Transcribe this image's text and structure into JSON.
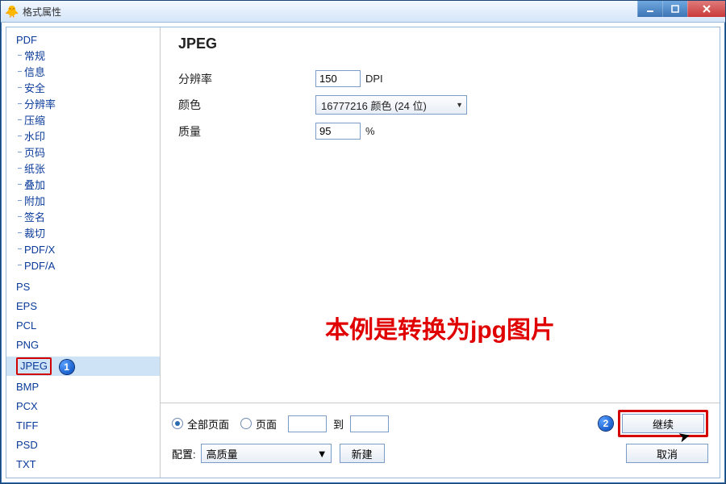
{
  "window": {
    "title": "格式属性",
    "icon_glyph": "🐥"
  },
  "sidebar": {
    "groups": [
      {
        "label": "PDF",
        "children": [
          "常规",
          "信息",
          "安全",
          "分辨率",
          "压缩",
          "水印",
          "页码",
          "纸张",
          "叠加",
          "附加",
          "签名",
          "裁切",
          "PDF/X",
          "PDF/A"
        ]
      },
      {
        "label": "PS"
      },
      {
        "label": "EPS"
      },
      {
        "label": "PCL"
      },
      {
        "label": "PNG"
      },
      {
        "label": "JPEG",
        "selected": true
      },
      {
        "label": "BMP"
      },
      {
        "label": "PCX"
      },
      {
        "label": "TIFF"
      },
      {
        "label": "PSD"
      },
      {
        "label": "TXT"
      }
    ]
  },
  "main": {
    "heading": "JPEG",
    "rows": {
      "resolution": {
        "label": "分辨率",
        "value": "150",
        "unit": "DPI"
      },
      "color": {
        "label": "颜色",
        "value": "16777216 颜色 (24 位)"
      },
      "quality": {
        "label": "质量",
        "value": "95",
        "unit": "%"
      }
    },
    "annotation": "本例是转换为jpg图片"
  },
  "bottom": {
    "radio_all": "全部页面",
    "radio_range": "页面",
    "to_label": "到",
    "range_from": "",
    "range_to": "",
    "config_label": "配置:",
    "config_value": "高质量",
    "new_btn": "新建",
    "continue_btn": "继续",
    "cancel_btn": "取消"
  },
  "badges": {
    "one": "1",
    "two": "2"
  }
}
